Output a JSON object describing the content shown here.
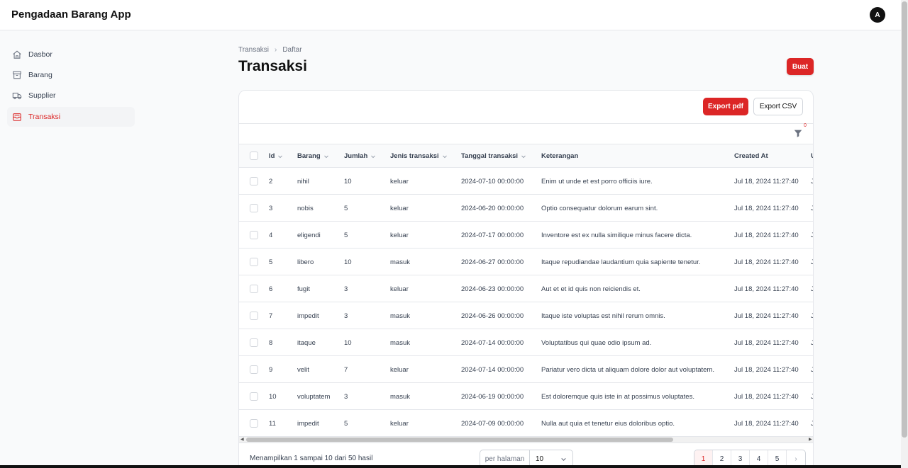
{
  "app": {
    "title": "Pengadaan Barang App",
    "avatar": "A"
  },
  "sidebar": {
    "items": [
      {
        "label": "Dasbor",
        "icon": "home-icon",
        "active": false
      },
      {
        "label": "Barang",
        "icon": "archive-box-icon",
        "active": false
      },
      {
        "label": "Supplier",
        "icon": "truck-icon",
        "active": false
      },
      {
        "label": "Transaksi",
        "icon": "inbox-icon",
        "active": true
      }
    ]
  },
  "breadcrumb": {
    "parent": "Transaksi",
    "current": "Daftar"
  },
  "page": {
    "title": "Transaksi",
    "create_label": "Buat"
  },
  "toolbar": {
    "export_pdf": "Export pdf",
    "export_csv": "Export CSV",
    "filter_count": "0"
  },
  "table": {
    "headers": {
      "id": "Id",
      "barang": "Barang",
      "jumlah": "Jumlah",
      "jenis": "Jenis transaksi",
      "tanggal": "Tanggal transaksi",
      "keterangan": "Keterangan",
      "created": "Created At",
      "updated": "U"
    },
    "rows": [
      {
        "id": "2",
        "barang": "nihil",
        "jumlah": "10",
        "jenis": "keluar",
        "tanggal": "2024-07-10 00:00:00",
        "keterangan": "Enim ut unde et est porro officiis iure.",
        "created": "Jul 18, 2024 11:27:40",
        "updated": "J"
      },
      {
        "id": "3",
        "barang": "nobis",
        "jumlah": "5",
        "jenis": "keluar",
        "tanggal": "2024-06-20 00:00:00",
        "keterangan": "Optio consequatur dolorum earum sint.",
        "created": "Jul 18, 2024 11:27:40",
        "updated": "J"
      },
      {
        "id": "4",
        "barang": "eligendi",
        "jumlah": "5",
        "jenis": "keluar",
        "tanggal": "2024-07-17 00:00:00",
        "keterangan": "Inventore est ex nulla similique minus facere dicta.",
        "created": "Jul 18, 2024 11:27:40",
        "updated": "J"
      },
      {
        "id": "5",
        "barang": "libero",
        "jumlah": "10",
        "jenis": "masuk",
        "tanggal": "2024-06-27 00:00:00",
        "keterangan": "Itaque repudiandae laudantium quia sapiente tenetur.",
        "created": "Jul 18, 2024 11:27:40",
        "updated": "J"
      },
      {
        "id": "6",
        "barang": "fugit",
        "jumlah": "3",
        "jenis": "keluar",
        "tanggal": "2024-06-23 00:00:00",
        "keterangan": "Aut et et id quis non reiciendis et.",
        "created": "Jul 18, 2024 11:27:40",
        "updated": "J"
      },
      {
        "id": "7",
        "barang": "impedit",
        "jumlah": "3",
        "jenis": "masuk",
        "tanggal": "2024-06-26 00:00:00",
        "keterangan": "Itaque iste voluptas est nihil rerum omnis.",
        "created": "Jul 18, 2024 11:27:40",
        "updated": "J"
      },
      {
        "id": "8",
        "barang": "itaque",
        "jumlah": "10",
        "jenis": "masuk",
        "tanggal": "2024-07-14 00:00:00",
        "keterangan": "Voluptatibus qui quae odio ipsum ad.",
        "created": "Jul 18, 2024 11:27:40",
        "updated": "J"
      },
      {
        "id": "9",
        "barang": "velit",
        "jumlah": "7",
        "jenis": "keluar",
        "tanggal": "2024-07-14 00:00:00",
        "keterangan": "Pariatur vero dicta ut aliquam dolore dolor aut voluptatem.",
        "created": "Jul 18, 2024 11:27:40",
        "updated": "J"
      },
      {
        "id": "10",
        "barang": "voluptatem",
        "jumlah": "3",
        "jenis": "masuk",
        "tanggal": "2024-06-19 00:00:00",
        "keterangan": "Est doloremque quis iste in at possimus voluptates.",
        "created": "Jul 18, 2024 11:27:40",
        "updated": "J"
      },
      {
        "id": "11",
        "barang": "impedit",
        "jumlah": "5",
        "jenis": "keluar",
        "tanggal": "2024-07-09 00:00:00",
        "keterangan": "Nulla aut quia et tenetur eius doloribus optio.",
        "created": "Jul 18, 2024 11:27:40",
        "updated": "J"
      }
    ]
  },
  "footer": {
    "showing": "Menampilkan 1 sampai 10 dari 50 hasil",
    "per_page_label": "per halaman",
    "per_page_value": "10",
    "pages": [
      "1",
      "2",
      "3",
      "4",
      "5"
    ],
    "current_page": "1",
    "next_icon": "chevron-right-icon"
  },
  "colors": {
    "accent": "#dc2626"
  }
}
